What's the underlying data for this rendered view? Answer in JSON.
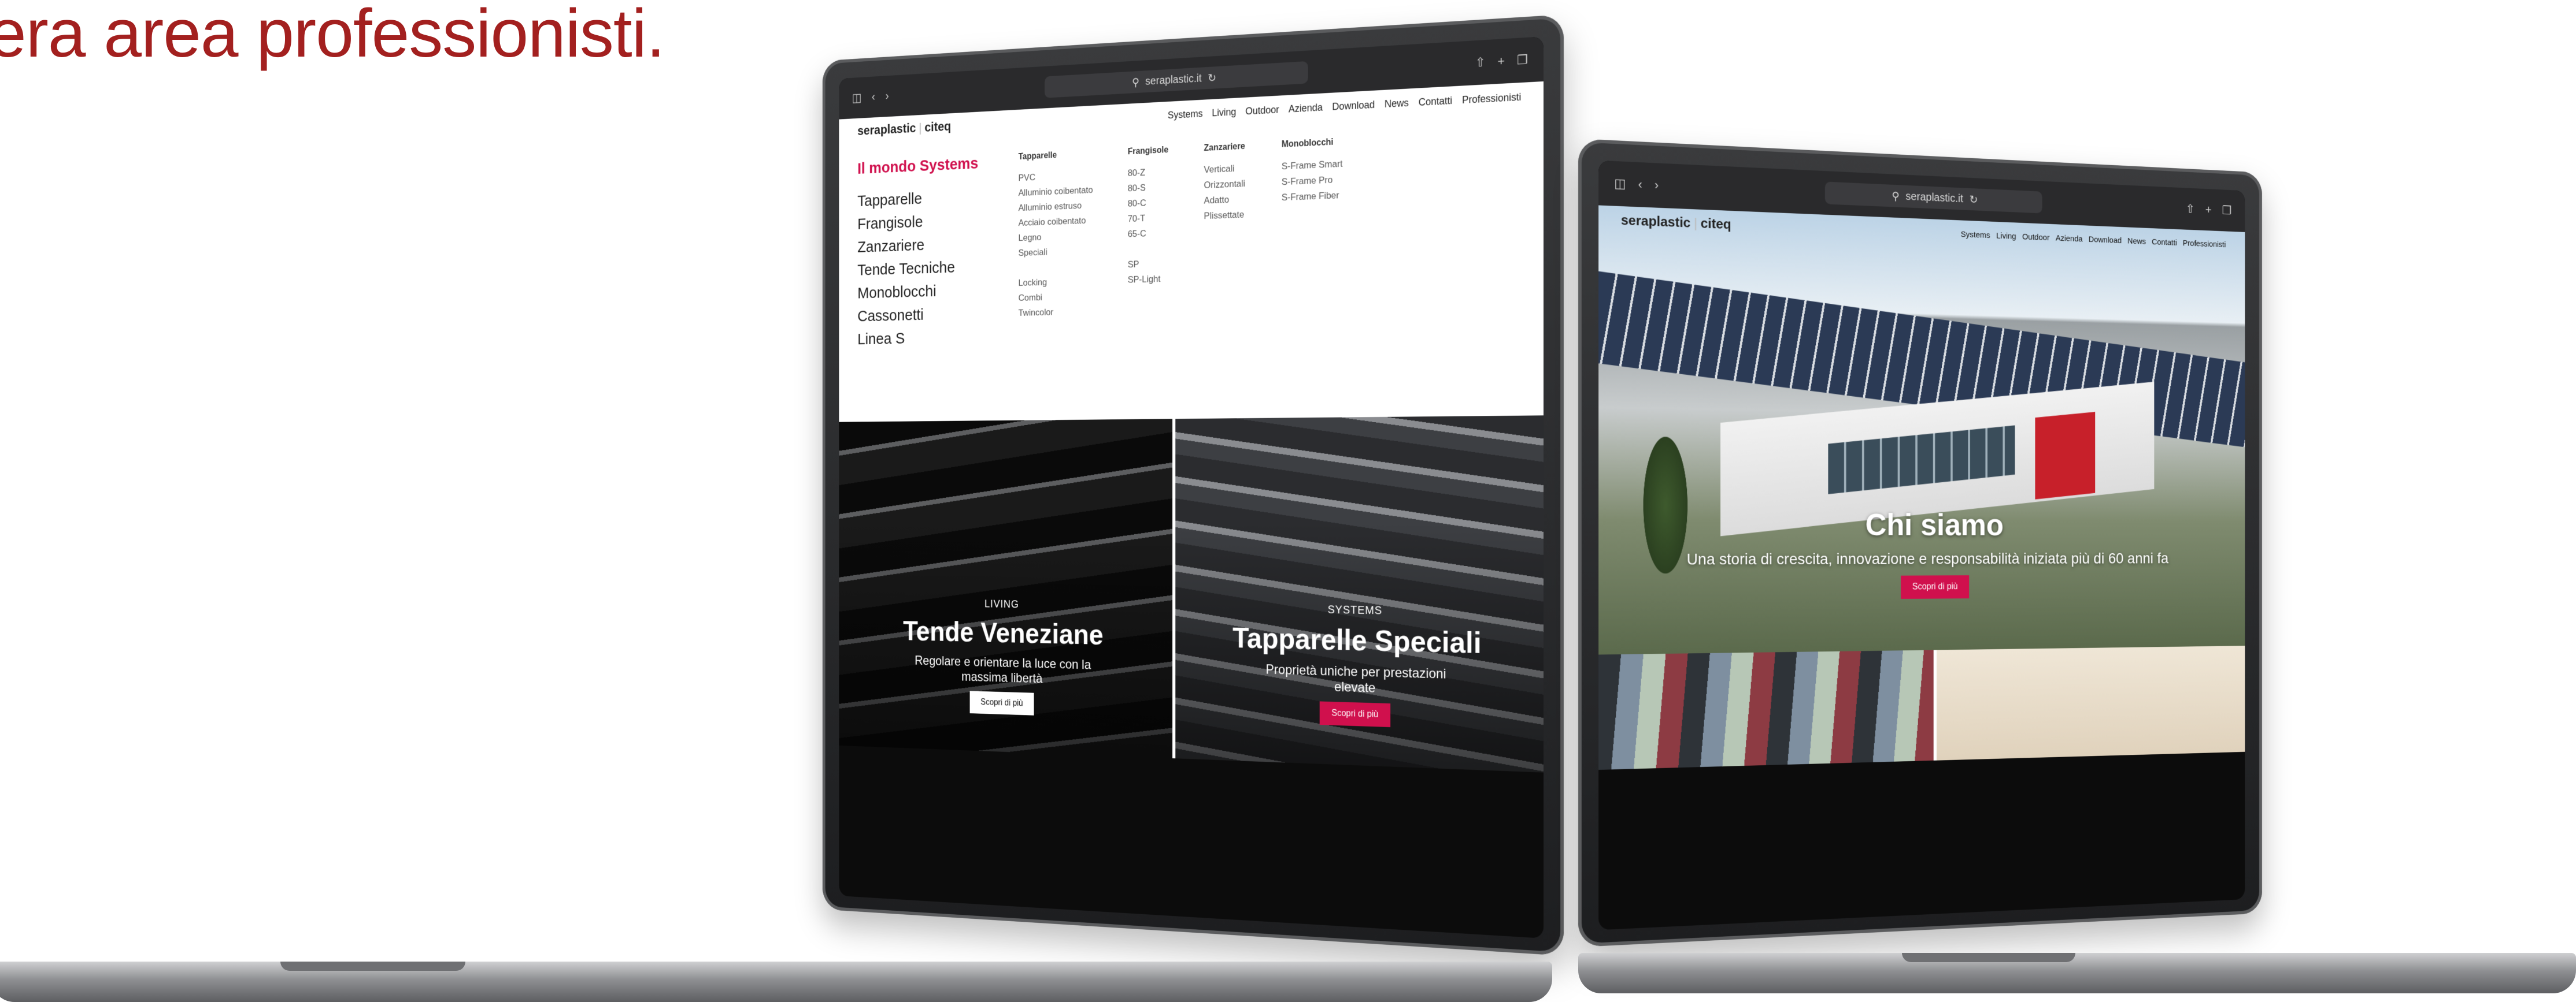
{
  "headline": "era area professionisti.",
  "browser": {
    "url": "seraplastic.it",
    "icons": [
      "sidebar-icon",
      "back-icon",
      "forward-icon",
      "reload-icon",
      "share-icon",
      "new-tab-icon",
      "tabs-icon"
    ]
  },
  "left_site": {
    "logo_main": "seraplastic",
    "logo_sub": "citeq",
    "nav": [
      "Systems",
      "Living",
      "Outdoor",
      "Azienda",
      "Download",
      "News",
      "Contatti",
      "Professionisti"
    ],
    "menu_heading": "Il mondo Systems",
    "menu_primary": [
      "Tapparelle",
      "Frangisole",
      "Zanzariere",
      "Tende Tecniche",
      "Monoblocchi",
      "Cassonetti",
      "Linea S"
    ],
    "col_tapparelle": {
      "title": "Tapparelle",
      "items": [
        "PVC",
        "Alluminio coibentato",
        "Alluminio estruso",
        "Acciaio coibentato",
        "Legno",
        "Speciali"
      ],
      "items2": [
        "Locking",
        "Combi",
        "Twincolor"
      ]
    },
    "col_frangisole": {
      "title": "Frangisole",
      "items": [
        "80-Z",
        "80-S",
        "80-C",
        "70-T",
        "65-C"
      ],
      "items2": [
        "SP",
        "SP-Light"
      ]
    },
    "col_zanzariere": {
      "title": "Zanzariere",
      "items": [
        "Verticali",
        "Orizzontali",
        "Adatto",
        "Plissettate"
      ]
    },
    "col_monoblocchi": {
      "title": "Monoblocchi",
      "items": [
        "S-Frame Smart",
        "S-Frame Pro",
        "S-Frame Fiber"
      ]
    },
    "panel_living": {
      "eyebrow": "LIVING",
      "title": "Tende Veneziane",
      "desc": "Regolare e orientare la luce con la massima libertà",
      "button": "Scopri di più"
    },
    "panel_systems": {
      "eyebrow": "SYSTEMS",
      "title": "Tapparelle Speciali",
      "desc": "Proprietà uniche per prestazioni elevate",
      "button": "Scopri di più"
    }
  },
  "right_site": {
    "logo_main": "seraplastic",
    "logo_sub": "citeq",
    "nav": [
      "Systems",
      "Living",
      "Outdoor",
      "Azienda",
      "Download",
      "News",
      "Contatti",
      "Professionisti"
    ],
    "hero_title": "Chi siamo",
    "hero_desc": "Una storia di crescita, innovazione e responsabilità iniziata più di 60 anni fa",
    "hero_button": "Scopri di più"
  },
  "colors": {
    "headline": "#a3201f",
    "accent": "#d0104d"
  }
}
